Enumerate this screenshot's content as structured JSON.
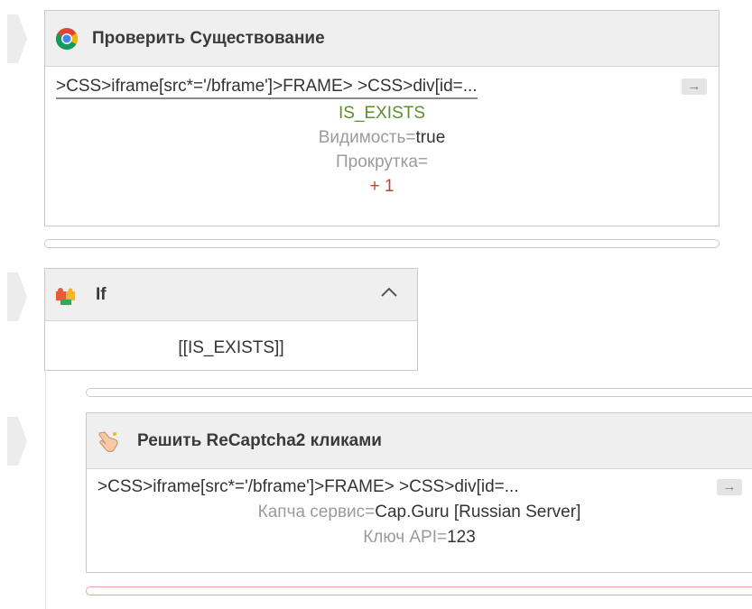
{
  "block1": {
    "title": "Проверить Существование",
    "icon": "chrome-icon",
    "selector": ">CSS>iframe[src*='/bframe']>FRAME> >CSS>div[id=...",
    "result_var": "IS_EXISTS",
    "visibility_label": "Видимость=",
    "visibility_value": "true",
    "scroll_label": "Прокрутка=",
    "offset": "+ 1",
    "arrow_glyph": "→"
  },
  "block2": {
    "title": "If",
    "icon": "puzzle-icon",
    "condition": "[[IS_EXISTS]]"
  },
  "block3": {
    "title": "Решить ReCaptcha2 кликами",
    "icon": "pointer-hand-icon",
    "selector": ">CSS>iframe[src*='/bframe']>FRAME> >CSS>div[id=...",
    "service_label": "Капча сервис=",
    "service_value": "Cap.Guru [Russian Server]",
    "apikey_label": "Ключ API=",
    "apikey_value": "123",
    "arrow_glyph": "→"
  },
  "colors": {
    "header_bg": "#efefef",
    "border": "#c9c9c9",
    "green_text": "#5c8f2d",
    "red_text": "#b64a2f",
    "muted_text": "#9b9b9b",
    "error_bar": "#e8a596"
  }
}
